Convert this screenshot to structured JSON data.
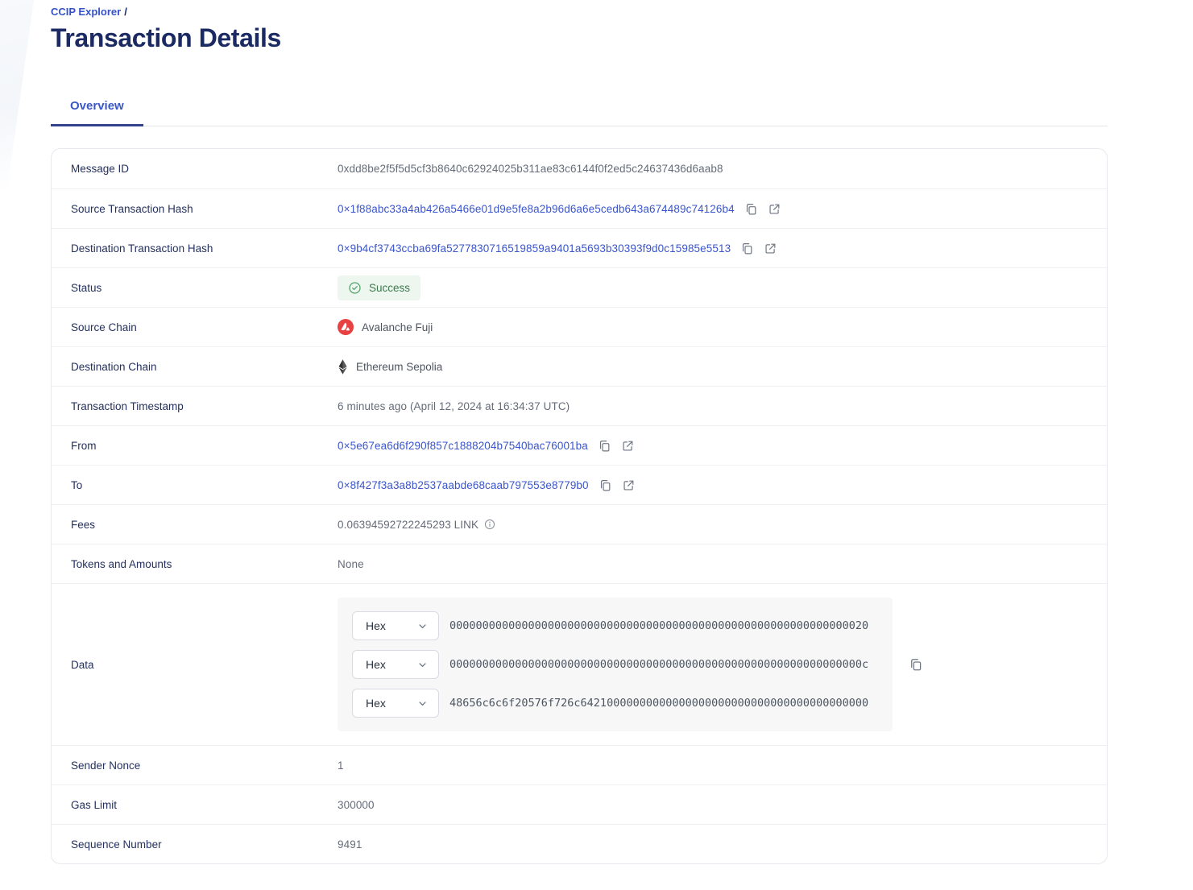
{
  "breadcrumb": {
    "link_label": "CCIP Explorer",
    "separator": "/"
  },
  "page_title": "Transaction Details",
  "tabs": [
    {
      "label": "Overview",
      "active": true
    }
  ],
  "colors": {
    "accent_blue": "#3a55cd",
    "heading_navy": "#1b2a63",
    "tab_indicator": "#33418f",
    "success_green_text": "#3a7a4e",
    "success_green_bg": "#edf6ef",
    "avalanche_red": "#e84142",
    "value_gray": "#656c79"
  },
  "rows": {
    "message_id": {
      "label": "Message ID",
      "value": "0xdd8be2f5f5d5cf3b8640c62924025b311ae83c6144f0f2ed5c24637436d6aab8"
    },
    "source_tx": {
      "label": "Source Transaction Hash",
      "value": "0×1f88abc33a4ab426a5466e01d9e5fe8a2b96d6a6e5cedb643a674489c74126b4"
    },
    "dest_tx": {
      "label": "Destination Transaction Hash",
      "value": "0×9b4cf3743ccba69fa5277830716519859a9401a5693b30393f9d0c15985e5513"
    },
    "status": {
      "label": "Status",
      "value": "Success"
    },
    "source_chain": {
      "label": "Source Chain",
      "value": "Avalanche Fuji"
    },
    "dest_chain": {
      "label": "Destination Chain",
      "value": "Ethereum Sepolia"
    },
    "timestamp": {
      "label": "Transaction Timestamp",
      "value": "6 minutes ago (April 12, 2024 at 16:34:37 UTC)"
    },
    "from": {
      "label": "From",
      "value": "0×5e67ea6d6f290f857c1888204b7540bac76001ba"
    },
    "to": {
      "label": "To",
      "value": "0×8f427f3a3a8b2537aabde68caab797553e8779b0"
    },
    "fees": {
      "label": "Fees",
      "value": "0.06394592722245293 LINK"
    },
    "tokens": {
      "label": "Tokens and Amounts",
      "value": "None"
    },
    "data": {
      "label": "Data",
      "selector_label": "Hex",
      "lines": [
        "0000000000000000000000000000000000000000000000000000000000000020",
        "000000000000000000000000000000000000000000000000000000000000000c",
        "48656c6c6f20576f726c64210000000000000000000000000000000000000000"
      ]
    },
    "sender_nonce": {
      "label": "Sender Nonce",
      "value": "1"
    },
    "gas_limit": {
      "label": "Gas Limit",
      "value": "300000"
    },
    "sequence_number": {
      "label": "Sequence Number",
      "value": "9491"
    }
  }
}
